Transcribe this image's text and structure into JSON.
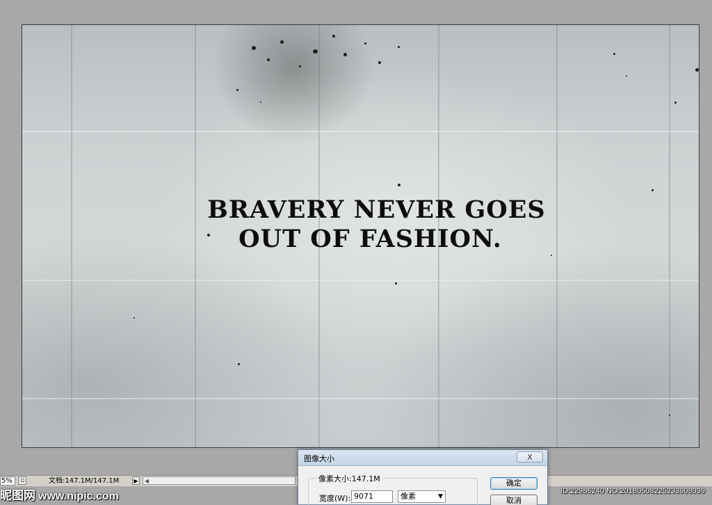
{
  "canvas": {
    "headline_line1": "BRAVERY NEVER GOES",
    "headline_line2": "OUT OF FASHION."
  },
  "statusbar": {
    "zoom": "5%",
    "doc_info": "文档:147.1M/147.1M"
  },
  "dialog": {
    "title": "图像大小",
    "close_label": "X",
    "pixel_size_label": "像素大小:147.1M",
    "width_label": "宽度(W):",
    "width_value": "9071",
    "unit_value": "像素",
    "ok_label": "确定",
    "cancel_label": "取消"
  },
  "watermark": {
    "brand": "昵图网",
    "url": "www.nipic.com",
    "id_text": "ID:22986240 NO:20180508225233908039"
  },
  "icons": {
    "doc_icon": "document-icon",
    "play": "play-triangle-icon",
    "scroll_left": "scroll-left-arrow-icon",
    "select_caret": "chevron-down-icon"
  }
}
